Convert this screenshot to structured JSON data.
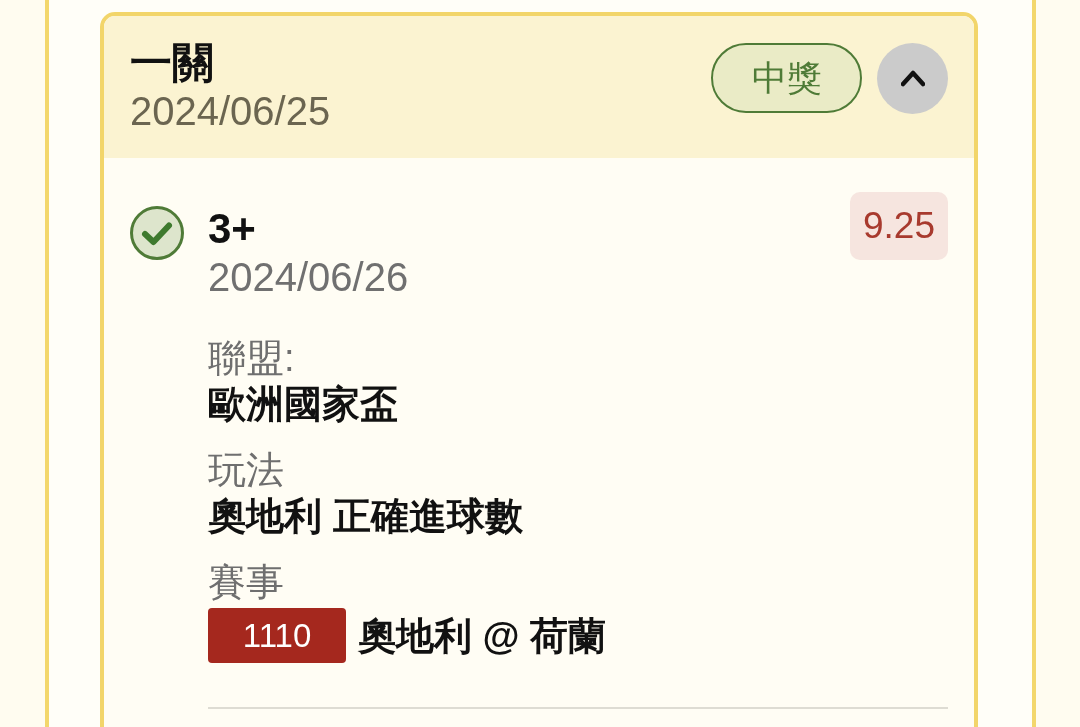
{
  "card": {
    "title": "一關",
    "date": "2024/06/25",
    "status": "中獎",
    "expanded": true
  },
  "legs": [
    {
      "won": true,
      "selection": "3+",
      "date": "2024/06/26",
      "odds": "9.25",
      "details": [
        {
          "kind": "text",
          "label": "聯盟:",
          "value": "歐洲國家盃"
        },
        {
          "kind": "text",
          "label": "玩法",
          "value": "奧地利 正確進球數"
        },
        {
          "kind": "match",
          "label": "賽事",
          "match_number": "1110",
          "value": "奧地利 @ 荷蘭"
        }
      ]
    }
  ]
}
